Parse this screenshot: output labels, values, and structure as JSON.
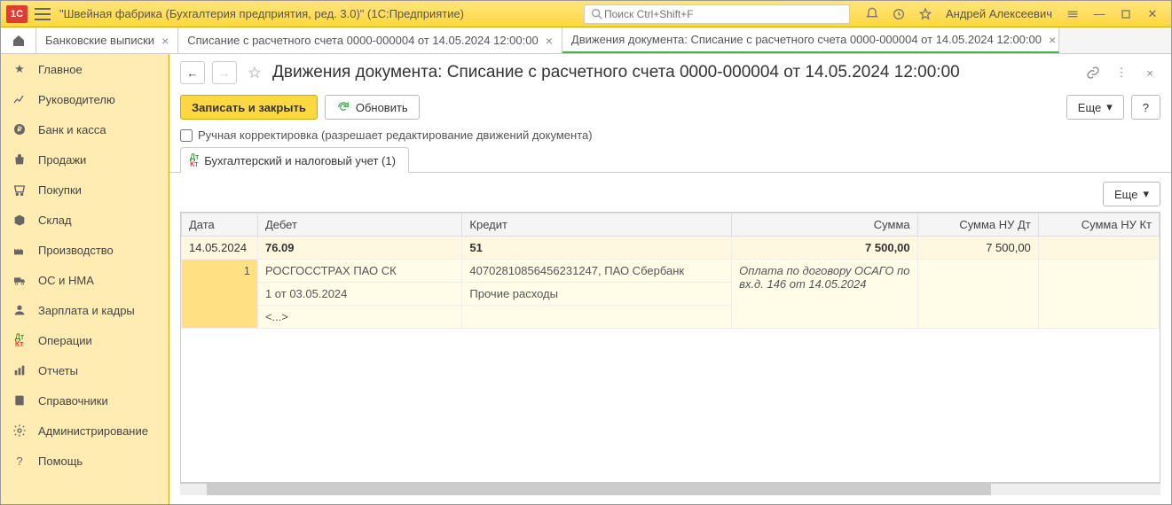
{
  "titlebar": {
    "app_title": "\"Швейная фабрика (Бухгалтерия предприятия, ред. 3.0)\"  (1С:Предприятие)",
    "search_placeholder": "Поиск Ctrl+Shift+F",
    "user": "Андрей Алексеевич"
  },
  "tabs": [
    {
      "label": "Банковские выписки"
    },
    {
      "label": "Списание с расчетного счета 0000-000004 от 14.05.2024 12:00:00"
    },
    {
      "label": "Движения документа: Списание с расчетного счета 0000-000004 от 14.05.2024 12:00:00",
      "active": true
    }
  ],
  "sidebar": [
    {
      "icon": "star",
      "label": "Главное"
    },
    {
      "icon": "chart",
      "label": "Руководителю"
    },
    {
      "icon": "ruble",
      "label": "Банк и касса"
    },
    {
      "icon": "bag",
      "label": "Продажи"
    },
    {
      "icon": "cart",
      "label": "Покупки"
    },
    {
      "icon": "box",
      "label": "Склад"
    },
    {
      "icon": "factory",
      "label": "Производство"
    },
    {
      "icon": "truck",
      "label": "ОС и НМА"
    },
    {
      "icon": "person",
      "label": "Зарплата и кадры"
    },
    {
      "icon": "dtkt",
      "label": "Операции"
    },
    {
      "icon": "bars",
      "label": "Отчеты"
    },
    {
      "icon": "book",
      "label": "Справочники"
    },
    {
      "icon": "gear",
      "label": "Администрирование"
    },
    {
      "icon": "help",
      "label": "Помощь"
    }
  ],
  "page": {
    "title": "Движения документа: Списание с расчетного счета 0000-000004 от 14.05.2024 12:00:00",
    "save_close": "Записать и закрыть",
    "refresh": "Обновить",
    "more": "Еще",
    "help": "?",
    "manual_edit": "Ручная корректировка (разрешает редактирование движений документа)",
    "subtab": "Бухгалтерский и налоговый учет (1)"
  },
  "table": {
    "headers": {
      "date": "Дата",
      "debit": "Дебет",
      "credit": "Кредит",
      "sum": "Сумма",
      "nu_dt": "Сумма НУ Дт",
      "nu_kt": "Сумма НУ Кт"
    },
    "rows": [
      {
        "date": "14.05.2024",
        "debit": "76.09",
        "credit": "51",
        "sum": "7 500,00",
        "nu_dt": "7 500,00",
        "nu_kt": ""
      },
      {
        "date": "1",
        "debit": "РОСГОССТРАХ ПАО СК",
        "credit": "40702810856456231247, ПАО Сбербанк",
        "sum": "Оплата по договору ОСАГО по вх.д. 146 от 14.05.2024"
      },
      {
        "debit": "1 от 03.05.2024",
        "credit": "Прочие расходы"
      },
      {
        "debit": "<...>"
      }
    ]
  }
}
